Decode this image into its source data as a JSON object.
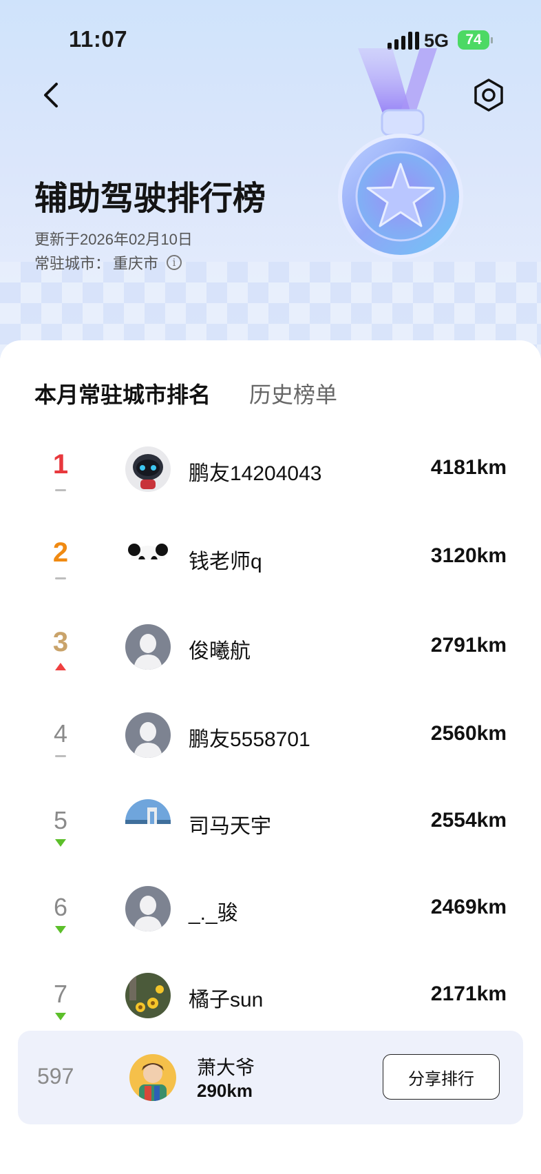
{
  "status_bar": {
    "time": "11:07",
    "network": "5G",
    "battery": "74"
  },
  "header": {
    "title": "辅助驾驶排行榜",
    "updated": "更新于2026年02月10日",
    "city_label": "常驻城市：",
    "city": "重庆市"
  },
  "tabs": [
    {
      "label": "本月常驻城市排名",
      "active": true
    },
    {
      "label": "历史榜单",
      "active": false
    }
  ],
  "leaderboard": [
    {
      "rank": "1",
      "name": "鹏友14204043",
      "distance": "4181km",
      "trend": "same",
      "avatar": "robot-avatar"
    },
    {
      "rank": "2",
      "name": "钱老师q",
      "distance": "3120km",
      "trend": "same",
      "avatar": "panda-avatar"
    },
    {
      "rank": "3",
      "name": "俊曦航",
      "distance": "2791km",
      "trend": "up",
      "avatar": "default-avatar"
    },
    {
      "rank": "4",
      "name": "鹏友5558701",
      "distance": "2560km",
      "trend": "same",
      "avatar": "default-avatar"
    },
    {
      "rank": "5",
      "name": "司马天宇",
      "distance": "2554km",
      "trend": "down",
      "avatar": "landscape-avatar"
    },
    {
      "rank": "6",
      "name": "_._骏",
      "distance": "2469km",
      "trend": "down",
      "avatar": "default-avatar"
    },
    {
      "rank": "7",
      "name": "橘子sun",
      "distance": "2171km",
      "trend": "down",
      "avatar": "flower-avatar"
    }
  ],
  "my_entry": {
    "rank": "597",
    "name": "萧大爷",
    "distance": "290km",
    "share_label": "分享排行"
  },
  "colors": {
    "rank1": "#e8383d",
    "rank2": "#f08a12",
    "rank3": "#c9a36a",
    "rank_other": "#8a8a8a",
    "up": "#ef4040",
    "down": "#5cbf2a"
  }
}
